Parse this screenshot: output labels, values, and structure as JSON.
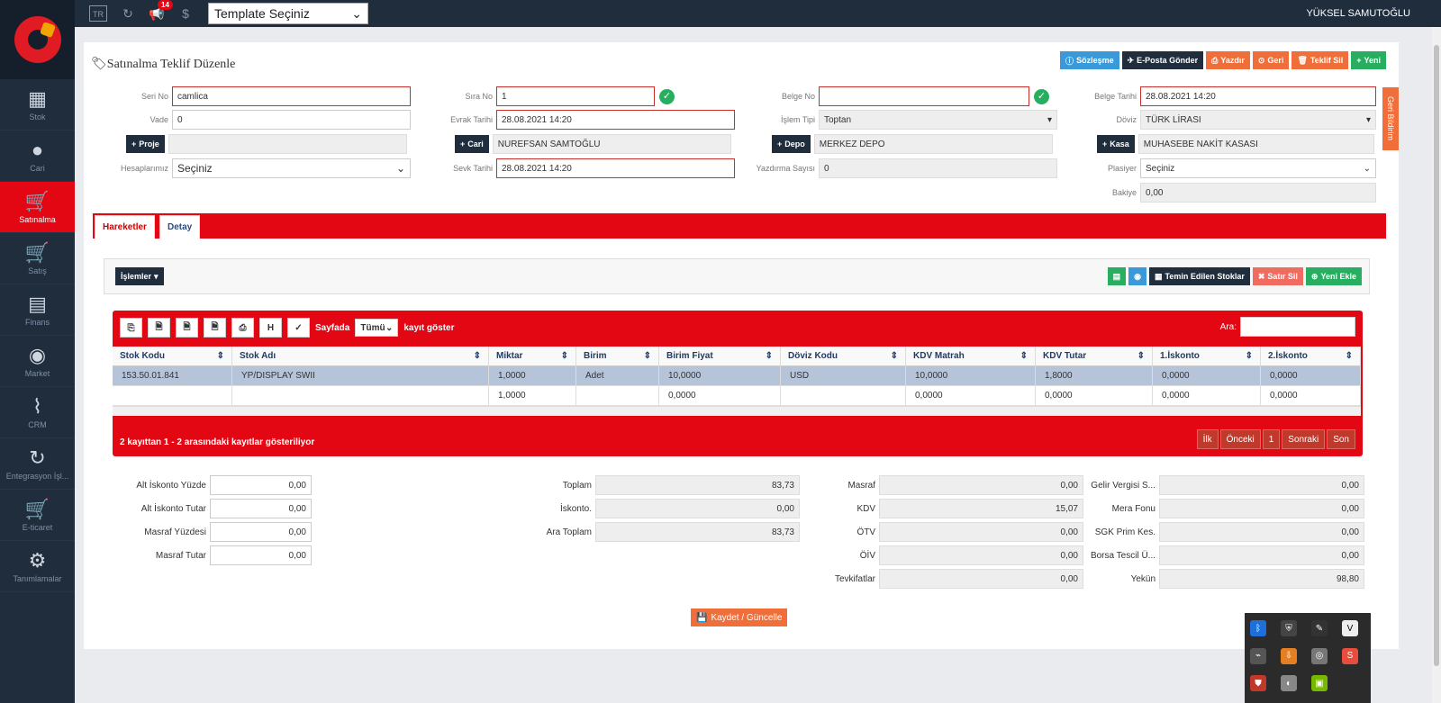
{
  "app": {
    "user": "YÜKSEL SAMUTOĞLU",
    "lang": "TR",
    "notif_count": "14",
    "template_select": "Template Seçiniz"
  },
  "sidebar": {
    "items": [
      {
        "label": "Stok",
        "icon": "cubes-icon"
      },
      {
        "label": "Cari",
        "icon": "user-icon"
      },
      {
        "label": "Satınalma",
        "icon": "cart-plus-icon",
        "active": true
      },
      {
        "label": "Satış",
        "icon": "cart-icon"
      },
      {
        "label": "Finans",
        "icon": "archive-icon"
      },
      {
        "label": "Market",
        "icon": "dashboard-icon"
      },
      {
        "label": "CRM",
        "icon": "paperclip-icon"
      },
      {
        "label": "Entegrasyon İşl...",
        "icon": "refresh-icon"
      },
      {
        "label": "E-ticaret",
        "icon": "shopping-cart-icon"
      },
      {
        "label": "Tanımlamalar",
        "icon": "cogs-icon"
      }
    ]
  },
  "page": {
    "title": "Satınalma Teklif Düzenle",
    "side_tab": "Geri Bildirim"
  },
  "toolbar": {
    "sozlesme": "Sözleşme",
    "eposta": "E-Posta Gönder",
    "yazdir": "Yazdır",
    "geri": "Geri",
    "teklif_sil": "Teklif Sil",
    "yeni": "Yeni"
  },
  "form": {
    "seri_no": {
      "label": "Seri No",
      "value": "camlica"
    },
    "vade": {
      "label": "Vade",
      "value": "0"
    },
    "proje": {
      "button": "Proje",
      "value": ""
    },
    "hesaplarimiz": {
      "label": "Hesaplarımız",
      "value": "Seçiniz"
    },
    "sira_no": {
      "label": "Sıra No",
      "value": "1"
    },
    "evrak_tarihi": {
      "label": "Evrak Tarihi",
      "value": "28.08.2021 14:20"
    },
    "cari": {
      "button": "Cari",
      "value": "NUREFSAN SAMTOĞLU"
    },
    "sevk_tarihi": {
      "label": "Sevk Tarihi",
      "value": "28.08.2021 14:20"
    },
    "belge_no": {
      "label": "Belge No",
      "value": ""
    },
    "islem_tipi": {
      "label": "İşlem Tipi",
      "value": "Toptan"
    },
    "depo": {
      "button": "Depo",
      "value": "MERKEZ DEPO"
    },
    "yazdirma_sayisi": {
      "label": "Yazdırma Sayısı",
      "value": "0"
    },
    "belge_tarihi": {
      "label": "Belge Tarihi",
      "value": "28.08.2021 14:20"
    },
    "doviz": {
      "label": "Döviz",
      "value": "TÜRK LİRASI"
    },
    "kasa": {
      "button": "Kasa",
      "value": "MUHASEBE NAKİT KASASI"
    },
    "plasiyer": {
      "label": "Plasiyer",
      "value": "Seçiniz"
    },
    "bakiye": {
      "label": "Bakiye",
      "value": "0,00"
    }
  },
  "tabs": [
    {
      "label": "Hareketler",
      "active": true
    },
    {
      "label": "Detay"
    }
  ],
  "actions": {
    "islemler": "İşlemler",
    "temin": "Temin Edilen Stoklar",
    "satir_sil": "Satır Sil",
    "yeni_ekle": "Yeni Ekle"
  },
  "grid": {
    "sayfada": "Sayfada",
    "page_size": "Tümü",
    "kayit_goster": "kayıt göster",
    "ara": "Ara:",
    "columns": [
      "Stok Kodu",
      "Stok Adı",
      "Miktar",
      "Birim",
      "Birim Fiyat",
      "Döviz Kodu",
      "KDV Matrah",
      "KDV Tutar",
      "1.İskonto",
      "2.İskonto"
    ],
    "rows": [
      [
        "153.50.01.841",
        "YP/DISPLAY SWII",
        "1,0000",
        "Adet",
        "10,0000",
        "USD",
        "10,0000",
        "1,8000",
        "0,0000",
        "0,0000"
      ],
      [
        "",
        "",
        "1,0000",
        "",
        "0,0000",
        "",
        "0,0000",
        "0,0000",
        "0,0000",
        "0,0000"
      ]
    ],
    "info": "2 kayıttan 1 - 2 arasındaki kayıtlar gösteriliyor",
    "pager": [
      "İlk",
      "Önceki",
      "1",
      "Sonraki",
      "Son"
    ]
  },
  "totals": {
    "col1": [
      {
        "label": "Alt İskonto Yüzde",
        "value": "0,00"
      },
      {
        "label": "Alt İskonto Tutar",
        "value": "0,00"
      },
      {
        "label": "Masraf Yüzdesi",
        "value": "0,00"
      },
      {
        "label": "Masraf Tutar",
        "value": "0,00"
      }
    ],
    "col2": [
      {
        "label": "Toplam",
        "value": "83,73"
      },
      {
        "label": "İskonto.",
        "value": "0,00"
      },
      {
        "label": "Ara Toplam",
        "value": "83,73"
      }
    ],
    "col3": [
      {
        "label": "Masraf",
        "value": "0,00"
      },
      {
        "label": "KDV",
        "value": "15,07"
      },
      {
        "label": "ÖTV",
        "value": "0,00"
      },
      {
        "label": "ÖİV",
        "value": "0,00"
      },
      {
        "label": "Tevkifatlar",
        "value": "0,00"
      }
    ],
    "col4": [
      {
        "label": "Gelir Vergisi S...",
        "value": "0,00"
      },
      {
        "label": "Mera Fonu",
        "value": "0,00"
      },
      {
        "label": "SGK Prim Kes.",
        "value": "0,00"
      },
      {
        "label": "Borsa Tescil Ü...",
        "value": "0,00"
      },
      {
        "label": "Yekün",
        "value": "98,80"
      }
    ]
  },
  "save_button": "Kaydet / Güncelle"
}
